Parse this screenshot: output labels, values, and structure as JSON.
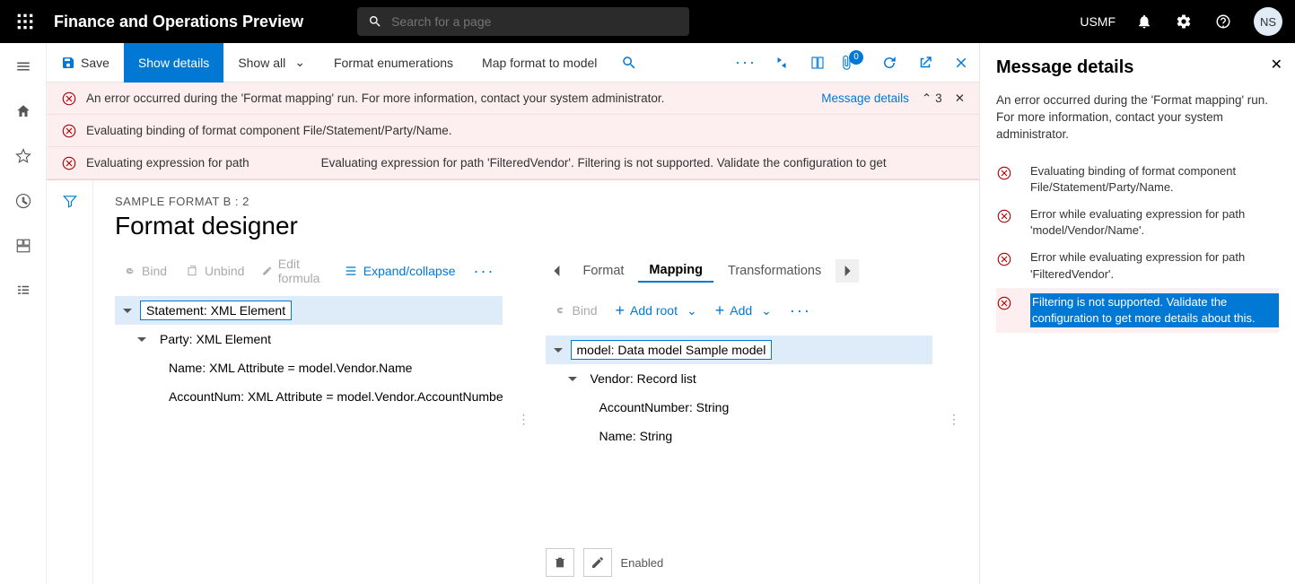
{
  "header": {
    "app_title": "Finance and Operations Preview",
    "search_placeholder": "Search for a page",
    "entity": "USMF",
    "avatar": "NS"
  },
  "cmdbar": {
    "save": "Save",
    "show_details": "Show details",
    "show_all": "Show all",
    "format_enum": "Format enumerations",
    "map_format": "Map format to model",
    "attach_badge": "0"
  },
  "messages": {
    "m1": "An error occurred during the 'Format mapping' run. For more information, contact your system administrator.",
    "details_link": "Message details",
    "count": "3",
    "m2": "Evaluating binding of format component File/Statement/Party/Name.",
    "m3a": "Evaluating expression for path",
    "m3b": "Evaluating expression for path 'FilteredVendor'. Filtering is not supported. Validate the configuration to get"
  },
  "designer": {
    "breadcrumb": "SAMPLE FORMAT B : 2",
    "title": "Format designer",
    "toolbar": {
      "bind": "Bind",
      "unbind": "Unbind",
      "edit": "Edit formula",
      "expand": "Expand/collapse"
    },
    "left_tree": {
      "n0": "Statement: XML Element",
      "n1": "Party: XML Element",
      "n2": "Name: XML Attribute = model.Vendor.Name",
      "n3": "AccountNum: XML Attribute = model.Vendor.AccountNumber"
    },
    "tabs": {
      "format": "Format",
      "mapping": "Mapping",
      "transformations": "Transformations"
    },
    "right_toolbar": {
      "bind": "Bind",
      "add_root": "Add root",
      "add": "Add"
    },
    "right_tree": {
      "n0": "model: Data model Sample model",
      "n1": "Vendor: Record list",
      "n2": "AccountNumber: String",
      "n3": "Name: String"
    },
    "enabled": "Enabled"
  },
  "details_panel": {
    "title": "Message details",
    "desc": "An error occurred during the 'Format mapping' run. For more information, contact your system administrator.",
    "i1": "Evaluating binding of format component File/Statement/Party/Name.",
    "i2": "Error while evaluating expression for path 'model/Vendor/Name'.",
    "i3": "Error while evaluating expression for path 'FilteredVendor'.",
    "i4": "Filtering is not supported. Validate the configuration to get more details about this."
  }
}
